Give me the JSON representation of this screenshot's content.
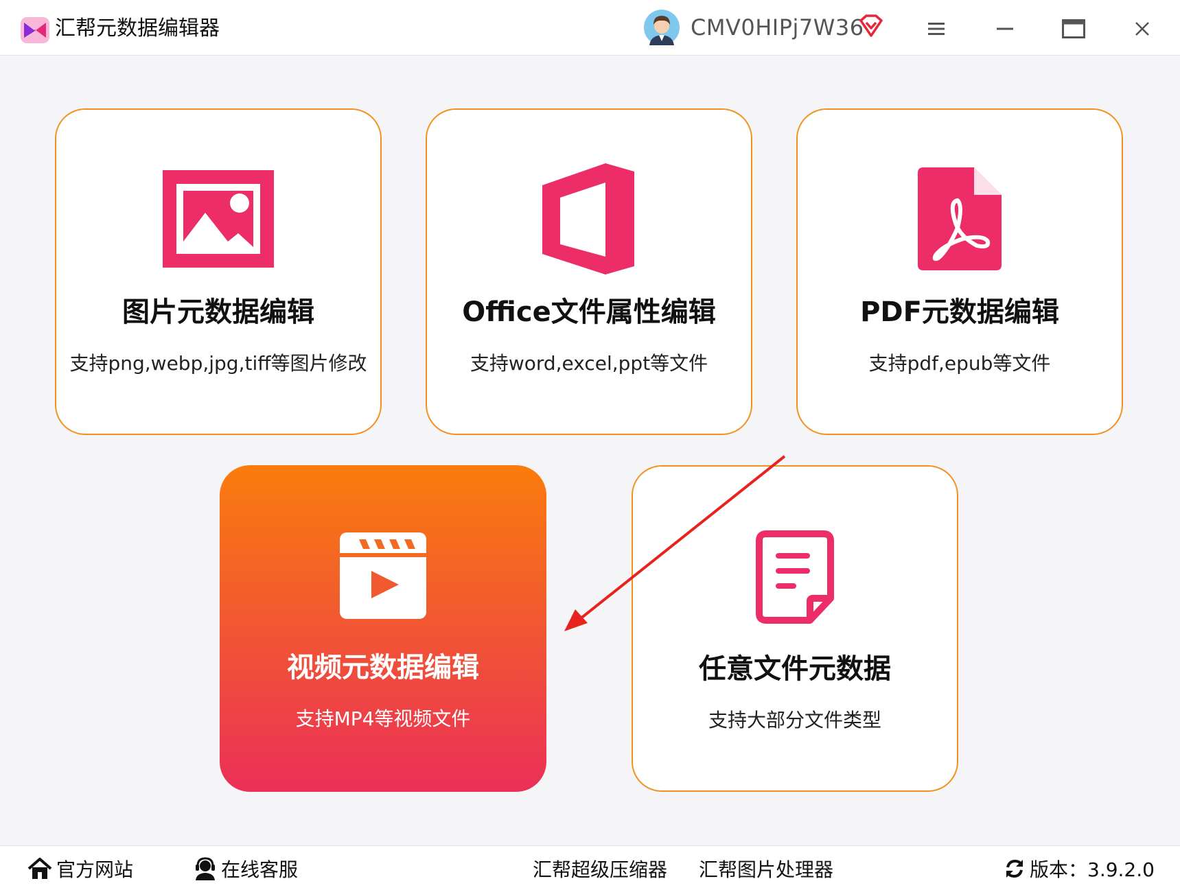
{
  "window": {
    "title": "汇帮元数据编辑器",
    "username": "CMV0HIPj7W36",
    "icons": [
      "app-logo-icon",
      "avatar",
      "vip-diamond-icon",
      "menu-icon",
      "minimize-icon",
      "maximize-icon",
      "close-icon"
    ]
  },
  "cards": [
    {
      "title": "图片元数据编辑",
      "desc": "支持png,webp,jpg,tiff等图片修改",
      "icon": "image-icon",
      "selected": false
    },
    {
      "title": "Office文件属性编辑",
      "desc": "支持word,excel,ppt等文件",
      "icon": "office-icon",
      "selected": false
    },
    {
      "title": "PDF元数据编辑",
      "desc": "支持pdf,epub等文件",
      "icon": "pdf-icon",
      "selected": false
    },
    {
      "title": "视频元数据编辑",
      "desc": "支持MP4等视频文件",
      "icon": "video-icon",
      "selected": true
    },
    {
      "title": "任意文件元数据",
      "desc": "支持大部分文件类型",
      "icon": "document-icon",
      "selected": false
    }
  ],
  "footer": {
    "website": "官方网站",
    "service": "在线客服",
    "compressor": "汇帮超级压缩器",
    "image_tool": "汇帮图片处理器",
    "version": "版本：3.9.2.0"
  },
  "colors": {
    "accent_pink": "#ec2d67",
    "border_orange": "#f09120",
    "active_gradient_top": "#fb7c0c",
    "active_gradient_bottom": "#ec2f58",
    "arrow_red": "#e8221c"
  }
}
